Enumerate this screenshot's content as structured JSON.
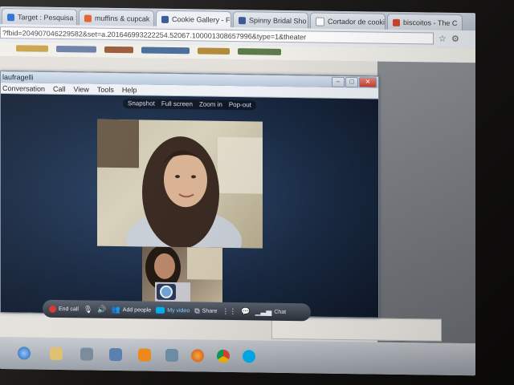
{
  "browser": {
    "tabs": [
      {
        "label": "Target : Pesquisa S",
        "favicon_color": "#2a6fd1"
      },
      {
        "label": "muffins & cupcak",
        "favicon_color": "#e0622a"
      },
      {
        "label": "Cookie Gallery - Fa",
        "favicon_color": "#3b5998"
      },
      {
        "label": "Spinny Bridal Sho",
        "favicon_color": "#3b5998"
      },
      {
        "label": "Cortador de cookie",
        "favicon_color": "#ffffff"
      },
      {
        "label": "biscoitos - The C",
        "favicon_color": "#d0452c"
      }
    ],
    "url": "?fbid=204907046229582&set=a.201646993222254.52067.100001308657996&type=1&theater",
    "star_icon": "star-icon",
    "wrench_icon": "wrench-icon"
  },
  "skype": {
    "title": "laufragelli",
    "menu": [
      "Conversation",
      "Call",
      "View",
      "Tools",
      "Help"
    ],
    "video_toolbar": [
      "Snapshot",
      "Full screen",
      "Zoom in",
      "Pop-out"
    ],
    "call_controls": {
      "end_call": "End call",
      "add_people": "Add people",
      "my_video": "My video",
      "share": "Share",
      "chat": "Chat"
    }
  },
  "colors": {
    "skype_stage": "#1a2b44",
    "end_call_red": "#d43a2a",
    "skype_blue": "#00aff0"
  }
}
